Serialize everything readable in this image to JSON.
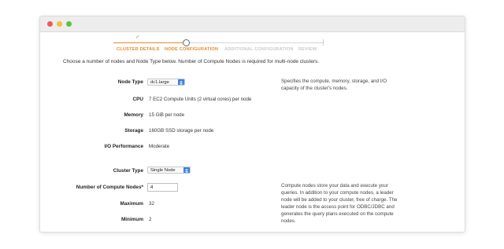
{
  "wizard": {
    "steps": [
      {
        "label": "CLUSTER DETAILS",
        "state": "done"
      },
      {
        "label": "NODE CONFIGURATION",
        "state": "active"
      },
      {
        "label": "ADDITIONAL CONFIGURATION",
        "state": "todo"
      },
      {
        "label": "REVIEW",
        "state": "todo"
      }
    ],
    "check_glyph": "✓"
  },
  "description": "Choose a number of nodes and Node Type below. Number of Compute Nodes is required for multi-node clusters.",
  "node": {
    "node_type_label": "Node Type",
    "node_type_value": "dc1.large",
    "node_type_help": "Specifies the compute, memory, storage, and I/O capacity of the cluster's nodes.",
    "cpu_label": "CPU",
    "cpu_value": "7 EC2 Compute Units (2 virtual cores) per node",
    "memory_label": "Memory",
    "memory_value": "15 GiB per node",
    "storage_label": "Storage",
    "storage_value": "160GB SSD storage per node",
    "io_label": "I/O Performance",
    "io_value": "Moderate"
  },
  "cluster": {
    "type_label": "Cluster Type",
    "type_value": "Single Node",
    "compute_nodes_label": "Number of Compute Nodes*",
    "compute_nodes_value": "4",
    "maximum_label": "Maximum",
    "maximum_value": "32",
    "minimum_label": "Minimum",
    "minimum_value": "2",
    "help": "Compute nodes store your data and execute your queries. In addition to your compute nodes, a leader node will be added to your cluster, free of charge. The leader node is the access point for ODBC/JDBC and generates the query plans executed on the compute nodes."
  },
  "colors": {
    "accent": "#e48a2f",
    "select_arrow": "#3a86e0",
    "inactive_step": "#c9c9c9"
  }
}
